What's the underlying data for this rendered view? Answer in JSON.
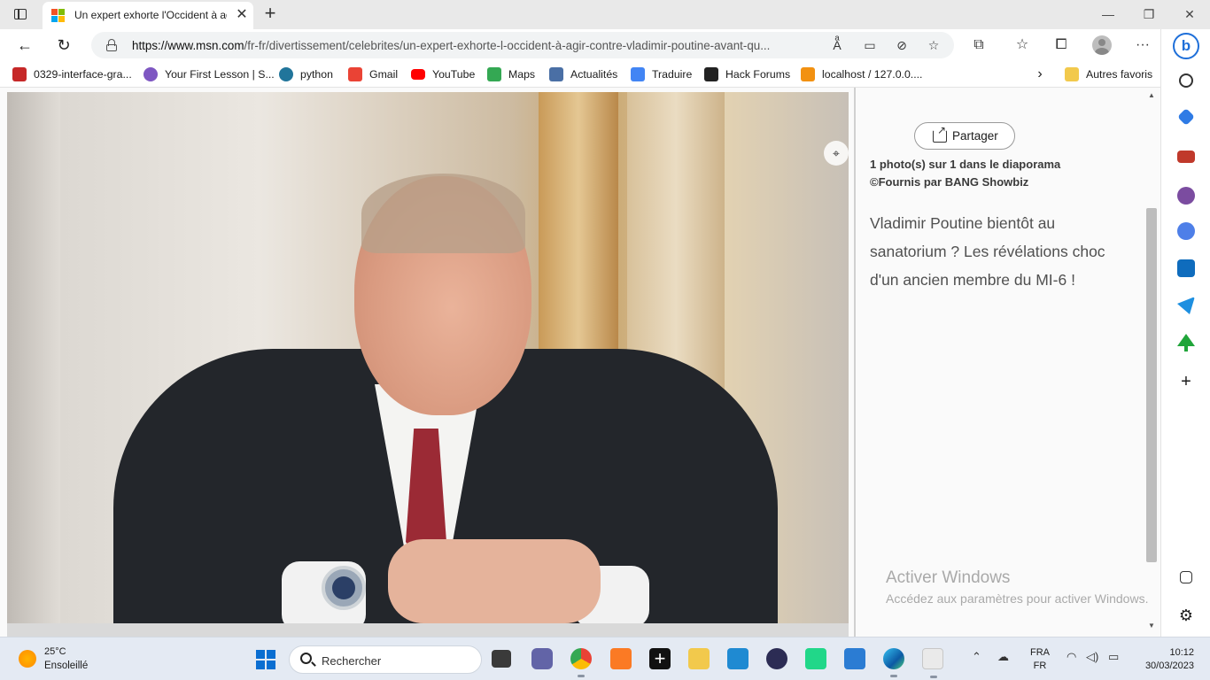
{
  "browser": {
    "tab": {
      "title": "Un expert exhorte l'Occident à agir",
      "close": "✕"
    },
    "window": {
      "minimize": "—",
      "restore": "❐",
      "close": "✕"
    },
    "url": {
      "host": "https://www.msn.com",
      "path": "/fr-fr/divertissement/celebrites/un-expert-exhorte-l-occident-à-agir-contre-vladimir-poutine-avant-qu..."
    },
    "favorites": [
      {
        "label": "0329-interface-gra...",
        "icon": "pdf-icon",
        "color": "#c62828"
      },
      {
        "label": "Your First Lesson | S...",
        "icon": "lesson-icon",
        "color": "#7e57c2"
      },
      {
        "label": "python",
        "icon": "wordpress-icon",
        "color": "#21759b"
      },
      {
        "label": "Gmail",
        "icon": "gmail-icon",
        "color": "#ea4335"
      },
      {
        "label": "YouTube",
        "icon": "youtube-icon",
        "color": "#ff0000"
      },
      {
        "label": "Maps",
        "icon": "maps-icon",
        "color": "#34a853"
      },
      {
        "label": "Actualités",
        "icon": "news-icon",
        "color": "#4a6fa5"
      },
      {
        "label": "Traduire",
        "icon": "translate-icon",
        "color": "#4285f4"
      },
      {
        "label": "Hack Forums",
        "icon": "hackforums-icon",
        "color": "#222222"
      },
      {
        "label": "localhost / 127.0.0....",
        "icon": "phpmyadmin-icon",
        "color": "#f29111"
      }
    ],
    "other_favorites": "Autres favoris"
  },
  "article": {
    "share_label": "Partager",
    "photo_count": "1 photo(s) sur 1 dans le diaporama",
    "photo_credit": "©Fournis par BANG Showbiz",
    "caption": "Vladimir Poutine bientôt au sanatorium ? Les révélations choc d'un ancien membre du MI-6 !"
  },
  "watermark": {
    "title": "Activer Windows",
    "subtitle": "Accédez aux paramètres pour activer Windows."
  },
  "taskbar": {
    "weather_temp": "25°C",
    "weather_desc": "Ensoleillé",
    "search_placeholder": "Rechercher",
    "lang_1": "FRA",
    "lang_2": "FR",
    "time": "10:12",
    "date": "30/03/2023"
  }
}
